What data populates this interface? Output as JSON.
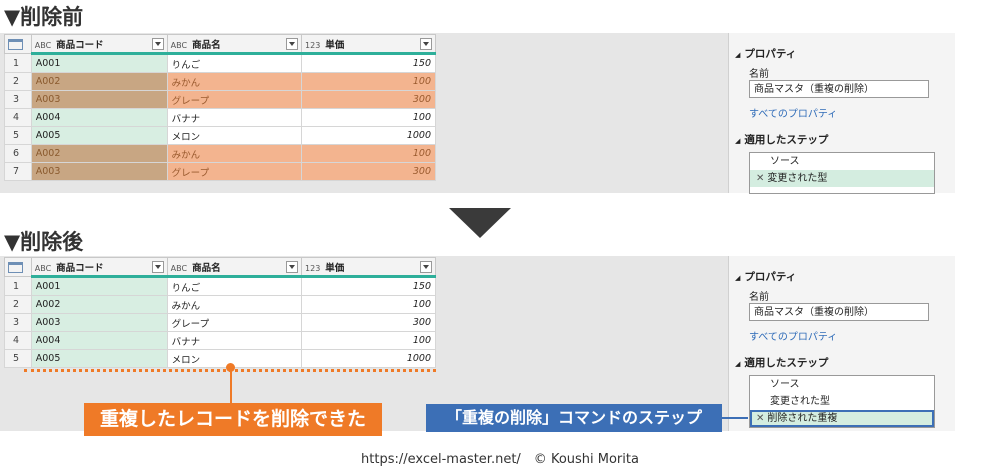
{
  "before": {
    "title": "▼削除前",
    "rows": [
      {
        "n": "1",
        "code": "A001",
        "name": "りんご",
        "price": "150",
        "dup": false
      },
      {
        "n": "2",
        "code": "A002",
        "name": "みかん",
        "price": "100",
        "dup": true
      },
      {
        "n": "3",
        "code": "A003",
        "name": "グレープ",
        "price": "300",
        "dup": true
      },
      {
        "n": "4",
        "code": "A004",
        "name": "バナナ",
        "price": "100",
        "dup": false
      },
      {
        "n": "5",
        "code": "A005",
        "name": "メロン",
        "price": "1000",
        "dup": false
      },
      {
        "n": "6",
        "code": "A002",
        "name": "みかん",
        "price": "100",
        "dup": true
      },
      {
        "n": "7",
        "code": "A003",
        "name": "グレープ",
        "price": "300",
        "dup": true
      }
    ],
    "steps": [
      "ソース",
      "変更された型"
    ]
  },
  "after": {
    "title": "▼削除後",
    "rows": [
      {
        "n": "1",
        "code": "A001",
        "name": "りんご",
        "price": "150",
        "dup": false
      },
      {
        "n": "2",
        "code": "A002",
        "name": "みかん",
        "price": "100",
        "dup": false
      },
      {
        "n": "3",
        "code": "A003",
        "name": "グレープ",
        "price": "300",
        "dup": false
      },
      {
        "n": "4",
        "code": "A004",
        "name": "バナナ",
        "price": "100",
        "dup": false
      },
      {
        "n": "5",
        "code": "A005",
        "name": "メロン",
        "price": "1000",
        "dup": false
      }
    ],
    "steps": [
      "ソース",
      "変更された型",
      "削除された重複"
    ]
  },
  "columns": {
    "code": {
      "type": "ABC",
      "label": "商品コード"
    },
    "name": {
      "type": "ABC",
      "label": "商品名"
    },
    "price": {
      "type": "123",
      "label": "単価"
    }
  },
  "props": {
    "section": "プロパティ",
    "name_label": "名前",
    "name_value": "商品マスタ（重複の削除）",
    "all_props": "すべてのプロパティ",
    "steps_section": "適用したステップ",
    "step_close": "✕"
  },
  "callouts": {
    "orange": "重複したレコードを削除できた",
    "blue": "「重複の削除」コマンドのステップ"
  },
  "footer": "https://excel-master.net/　© Koushi Morita",
  "colors": {
    "accent_teal": "#2eaf9a",
    "dup_orange": "#f3b48f",
    "callout_orange": "#ef7a27",
    "callout_blue": "#3c6fb6"
  }
}
